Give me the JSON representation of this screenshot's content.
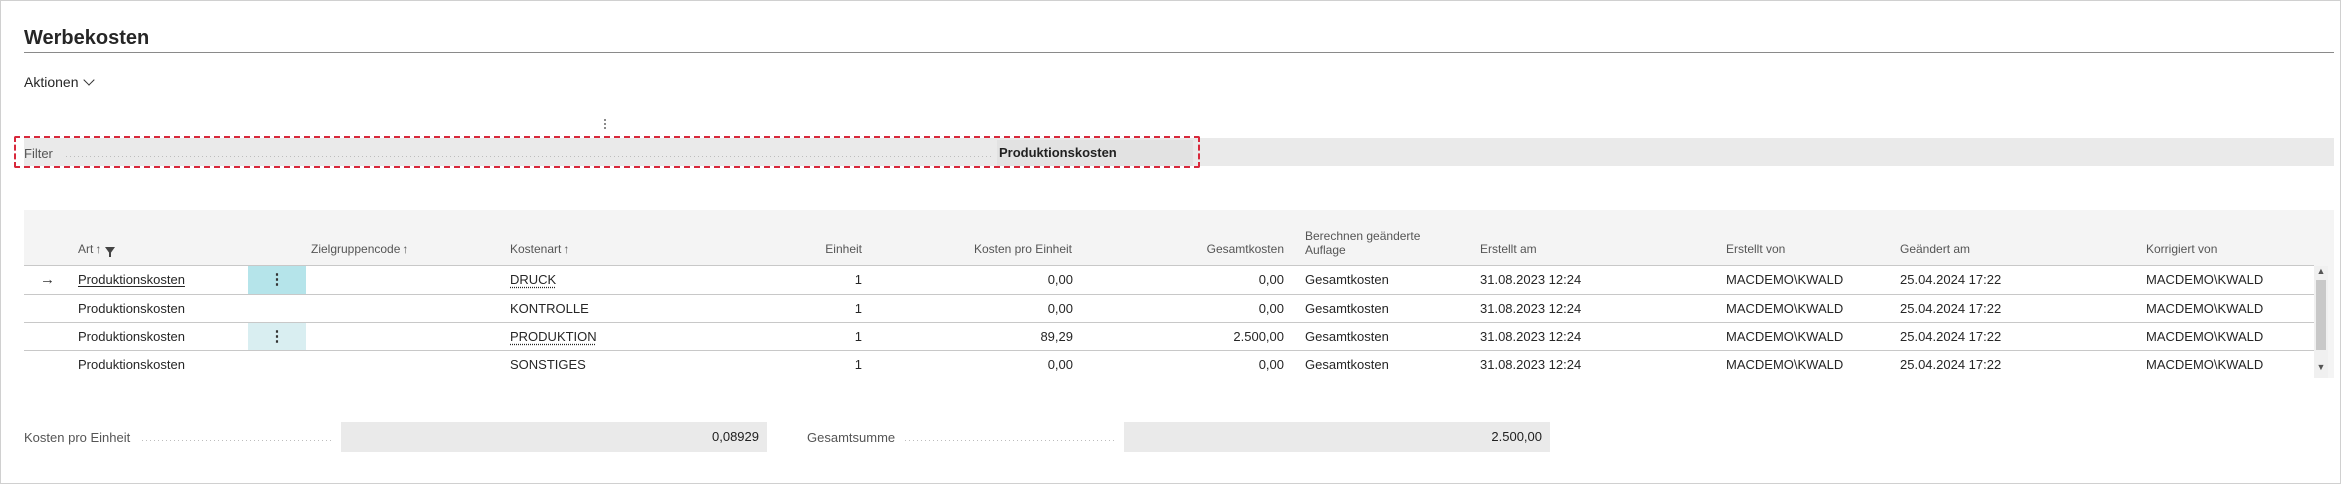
{
  "page": {
    "title": "Werbekosten"
  },
  "actions": {
    "label": "Aktionen"
  },
  "filter": {
    "label": "Filter",
    "value": "Produktionskosten"
  },
  "table": {
    "columns": {
      "art": "Art",
      "zielgruppencode": "Zielgruppencode",
      "kostenart": "Kostenart",
      "einheit": "Einheit",
      "kosten_pro_einheit": "Kosten pro Einheit",
      "gesamtkosten": "Gesamtkosten",
      "berechnen_1": "Berechnen geänderte",
      "berechnen_2": "Auflage",
      "erstellt_am": "Erstellt am",
      "erstellt_von": "Erstellt von",
      "geaendert_am": "Geändert am",
      "korrigiert_von": "Korrigiert von"
    },
    "sort_arrow": "↑",
    "row_arrow": "→",
    "rows": [
      {
        "art": "Produktionskosten",
        "zielgruppencode": "",
        "kostenart": "DRUCK",
        "einheit": "1",
        "kosten_pro_einheit": "0,00",
        "gesamtkosten": "0,00",
        "berechnen": "Gesamtkosten",
        "erstellt_am": "31.08.2023 12:24",
        "erstellt_von": "MACDEMO\\KWALD",
        "geaendert_am": "25.04.2024 17:22",
        "korrigiert_von": "MACDEMO\\KWALD"
      },
      {
        "art": "Produktionskosten",
        "zielgruppencode": "",
        "kostenart": "KONTROLLE",
        "einheit": "1",
        "kosten_pro_einheit": "0,00",
        "gesamtkosten": "0,00",
        "berechnen": "Gesamtkosten",
        "erstellt_am": "31.08.2023 12:24",
        "erstellt_von": "MACDEMO\\KWALD",
        "geaendert_am": "25.04.2024 17:22",
        "korrigiert_von": "MACDEMO\\KWALD"
      },
      {
        "art": "Produktionskosten",
        "zielgruppencode": "",
        "kostenart": "PRODUKTION",
        "einheit": "1",
        "kosten_pro_einheit": "89,29",
        "gesamtkosten": "2.500,00",
        "berechnen": "Gesamtkosten",
        "erstellt_am": "31.08.2023 12:24",
        "erstellt_von": "MACDEMO\\KWALD",
        "geaendert_am": "25.04.2024 17:22",
        "korrigiert_von": "MACDEMO\\KWALD"
      },
      {
        "art": "Produktionskosten",
        "zielgruppencode": "",
        "kostenart": "SONSTIGES",
        "einheit": "1",
        "kosten_pro_einheit": "0,00",
        "gesamtkosten": "0,00",
        "berechnen": "Gesamtkosten",
        "erstellt_am": "31.08.2023 12:24",
        "erstellt_von": "MACDEMO\\KWALD",
        "geaendert_am": "25.04.2024 17:22",
        "korrigiert_von": "MACDEMO\\KWALD"
      }
    ]
  },
  "totals": {
    "kosten_pro_einheit_label": "Kosten pro Einheit",
    "kosten_pro_einheit_value": "0,08929",
    "gesamtsumme_label": "Gesamtsumme",
    "gesamtsumme_value": "2.500,00"
  },
  "colors": {
    "selection": "#b5e4ea",
    "filter_border": "#d8283b",
    "header_bg": "#f4f4f4"
  }
}
